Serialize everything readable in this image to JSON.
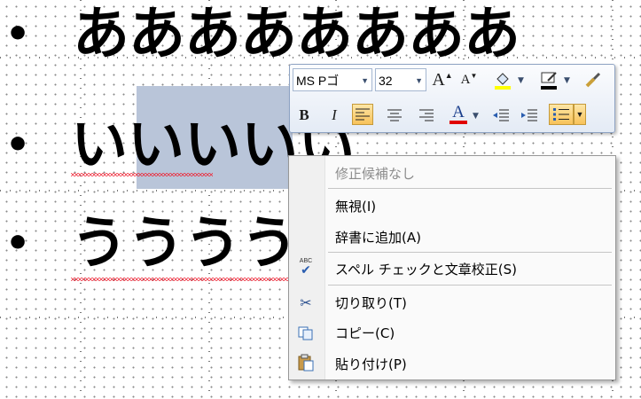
{
  "slide": {
    "lines": [
      {
        "bullet": "•",
        "text": "ああああああああ"
      },
      {
        "bullet": "•",
        "text": "いいいいい"
      },
      {
        "bullet": "•",
        "text": "うううううう"
      }
    ]
  },
  "mini_toolbar": {
    "font_name": "MS Pゴ",
    "font_size": "32",
    "grow_font": "A",
    "shrink_font": "A",
    "bold": "B",
    "italic": "I",
    "font_color": "A"
  },
  "context_menu": {
    "no_suggestions": "修正候補なし",
    "ignore": "無視(I)",
    "add_to_dictionary": "辞書に追加(A)",
    "spelling": "スペル チェックと文章校正(S)",
    "cut": "切り取り(T)",
    "copy": "コピー(C)",
    "paste": "貼り付け(P)",
    "spell_icon_text": "ABC"
  },
  "colors": {
    "selection": "#b9c5d9",
    "spell_error": "#e22233",
    "font_color_bar": "#e00000",
    "highlight_bar": "#ffff00"
  }
}
